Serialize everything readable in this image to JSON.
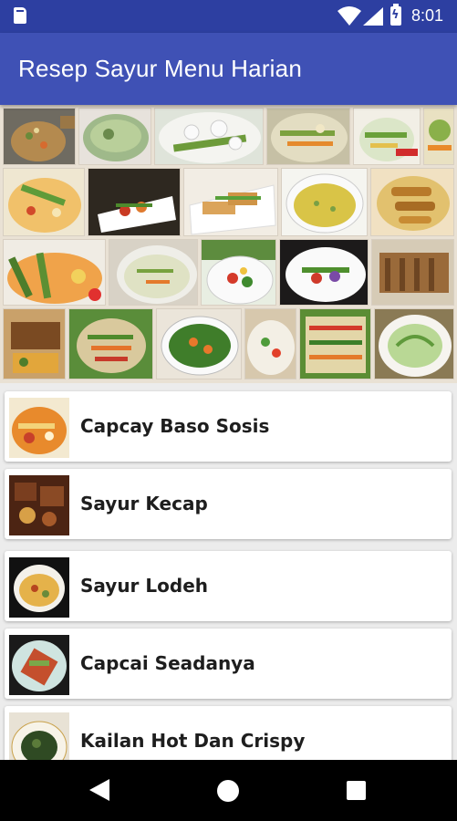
{
  "status_bar": {
    "time": "8:01",
    "icons": [
      "sd-card-icon",
      "wifi-icon",
      "signal-icon",
      "battery-icon"
    ]
  },
  "app_bar": {
    "title": "Resep Sayur Menu Harian",
    "background": "#3f51b5",
    "status_background": "#2d3fa1"
  },
  "banner": {
    "description_tiles": 24
  },
  "recipes": [
    {
      "name": "Capcay Baso Sosis",
      "thumb_colors": [
        "#e88a2c",
        "#f3d37a",
        "#c8402a"
      ]
    },
    {
      "name": "Sayur Kecap",
      "thumb_colors": [
        "#7a3e1f",
        "#d8a047",
        "#4c2413"
      ]
    },
    {
      "name": "Sayur Lodeh",
      "thumb_colors": [
        "#111111",
        "#e5b24a",
        "#b6451f"
      ]
    },
    {
      "name": "Capcai Seadanya",
      "thumb_colors": [
        "#1a1a1a",
        "#c44f2d",
        "#7aa84a"
      ]
    },
    {
      "name": "Kailan Hot Dan Crispy",
      "thumb_colors": [
        "#e8e2d5",
        "#2f4a23",
        "#5b7b3a"
      ]
    }
  ],
  "nav_bar": {
    "icons": [
      "back-icon",
      "home-icon",
      "recents-icon"
    ]
  }
}
